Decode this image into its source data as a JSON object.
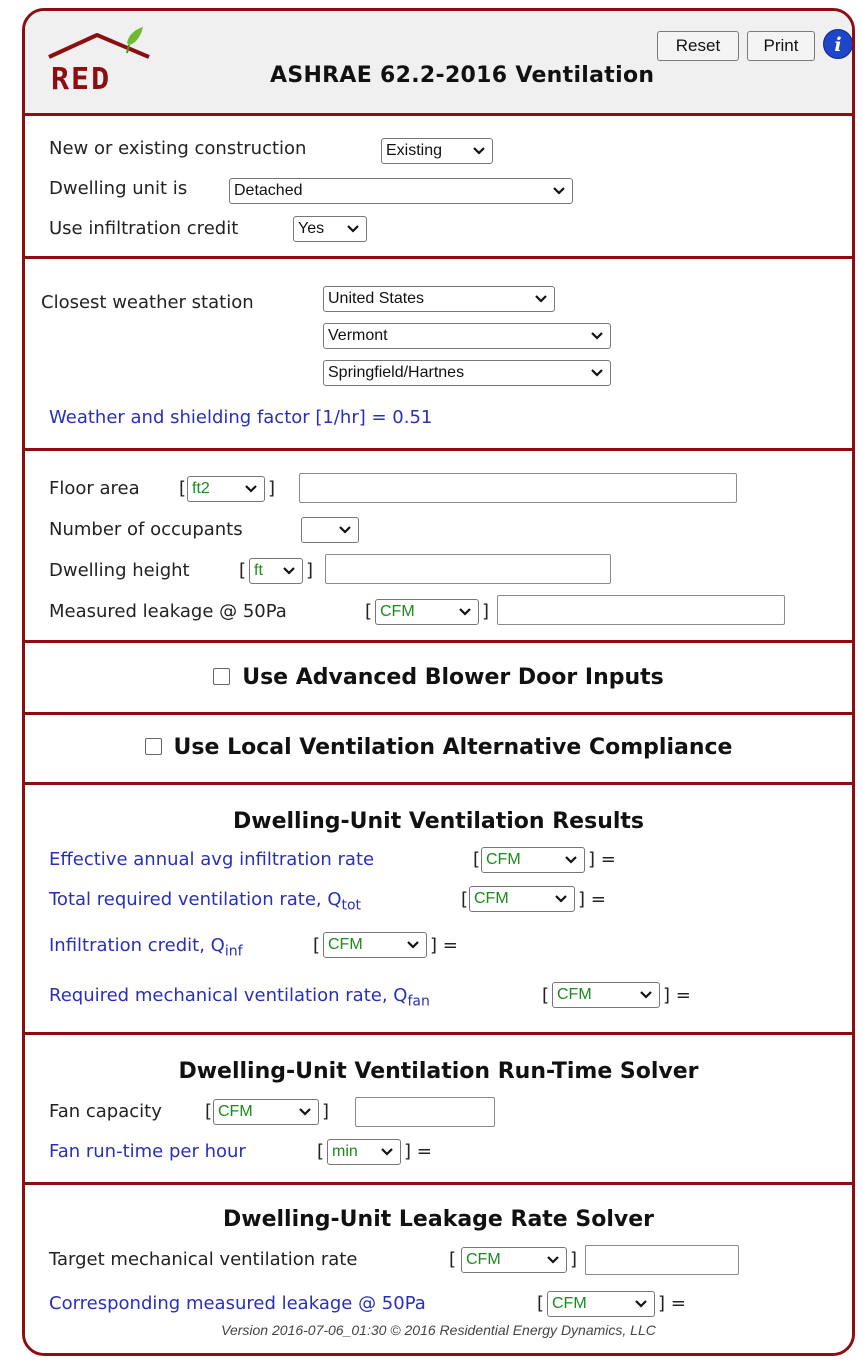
{
  "header": {
    "title": "ASHRAE 62.2-2016 Ventilation",
    "logo_text": "RED",
    "reset_label": "Reset",
    "print_label": "Print",
    "info_label": "i"
  },
  "construction": {
    "new_existing_label": "New or existing construction",
    "new_existing_value": "Existing",
    "dwelling_label": "Dwelling unit is",
    "dwelling_value": "Detached",
    "infiltration_label": "Use infiltration credit",
    "infiltration_value": "Yes"
  },
  "weather": {
    "label": "Closest weather station",
    "country": "United States",
    "state": "Vermont",
    "station": "Springfield/Hartnes",
    "factor_text": "Weather and shielding factor [1/hr] = 0.51"
  },
  "inputs": {
    "floor_area_label": "Floor area",
    "floor_area_unit": "ft2",
    "occupants_label": "Number of occupants",
    "occupants_value": "",
    "height_label": "Dwelling height",
    "height_unit": "ft",
    "leakage_label": "Measured leakage @ 50Pa",
    "leakage_unit": "CFM"
  },
  "advanced": {
    "label": "Use Advanced Blower Door Inputs"
  },
  "local": {
    "label": "Use Local Ventilation Alternative Compliance"
  },
  "results": {
    "heading": "Dwelling-Unit Ventilation Results",
    "infiltration_rate_label": "Effective annual avg infiltration rate",
    "total_label": "Total required ventilation rate, Q",
    "total_sub": "tot",
    "credit_label": "Infiltration credit, Q",
    "credit_sub": "inf",
    "mech_label": "Required mechanical ventilation rate, Q",
    "mech_sub": "fan",
    "unit": "CFM"
  },
  "runtime": {
    "heading": "Dwelling-Unit Ventilation Run-Time Solver",
    "fan_capacity_label": "Fan capacity",
    "fan_unit": "CFM",
    "runtime_label": "Fan run-time per hour",
    "runtime_unit": "min"
  },
  "leakage_solver": {
    "heading": "Dwelling-Unit Leakage Rate Solver",
    "target_label": "Target mechanical ventilation rate",
    "target_unit": "CFM",
    "corresponding_label": "Corresponding measured leakage @ 50Pa",
    "corresponding_unit": "CFM"
  },
  "footer": {
    "text": "Version 2016-07-06_01:30 © 2016 Residential Energy Dynamics, LLC"
  },
  "colors": {
    "border": "#8b0e12",
    "blue_text": "#2a2fb8",
    "unit_green": "#1c8a1c",
    "info_blue": "#1f45c8"
  }
}
